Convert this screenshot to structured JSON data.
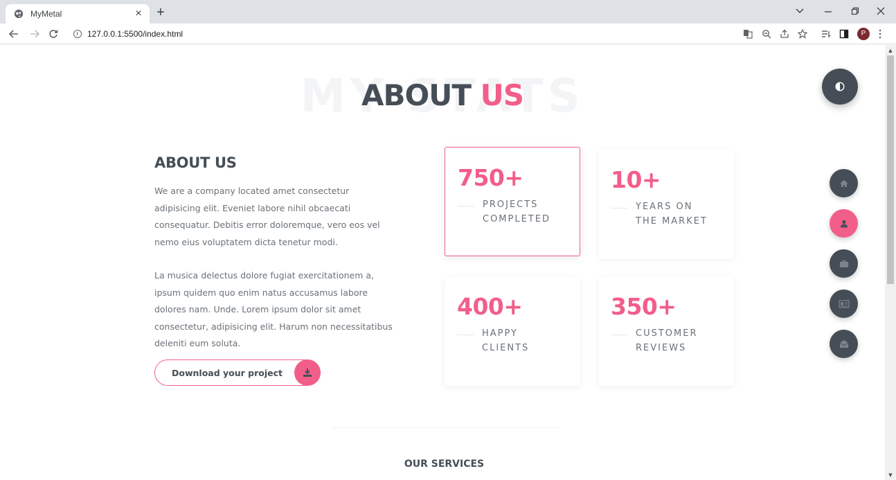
{
  "browser": {
    "tab_title": "MyMetal",
    "url": "127.0.0.1:5500/index.html",
    "profile_initial": "P",
    "newtab_glyph": "+",
    "close_glyph": "×"
  },
  "hero": {
    "bg_text": "MY STATS",
    "title_main": "ABOUT ",
    "title_accent": "US"
  },
  "about": {
    "heading": "ABOUT US",
    "para1": "We are a company located amet consectetur adipisicing elit. Eveniet labore nihil obcaecati consequatur. Debitis error doloremque, vero eos vel nemo eius voluptatem dicta tenetur modi.",
    "para2": "La musica delectus dolore fugiat exercitationem a, ipsum quidem quo enim natus accusamus labore dolores nam. Unde. Lorem ipsum dolor sit amet consectetur, adipisicing elit. Harum non necessitatibus deleniti eum soluta.",
    "download_label": "Download your project"
  },
  "stats": [
    {
      "number": "750+",
      "label_line1": "PROJECTS",
      "label_line2": "COMPLETED"
    },
    {
      "number": "10+",
      "label_line1": "YEARS ON",
      "label_line2": "THE MARKET"
    },
    {
      "number": "400+",
      "label_line1": "HAPPY",
      "label_line2": "CLIENTS"
    },
    {
      "number": "350+",
      "label_line1": "CUSTOMER",
      "label_line2": "REVIEWS"
    }
  ],
  "next_section": {
    "title": "OUR SERVICES"
  },
  "colors": {
    "accent": "#f25e8a",
    "dark": "#454e56",
    "text": "#6a7178"
  },
  "side_nav": [
    "home-icon",
    "user-icon",
    "briefcase-icon",
    "newspaper-icon",
    "envelope-open-icon"
  ],
  "theme_toggle_icon": "adjust-icon"
}
